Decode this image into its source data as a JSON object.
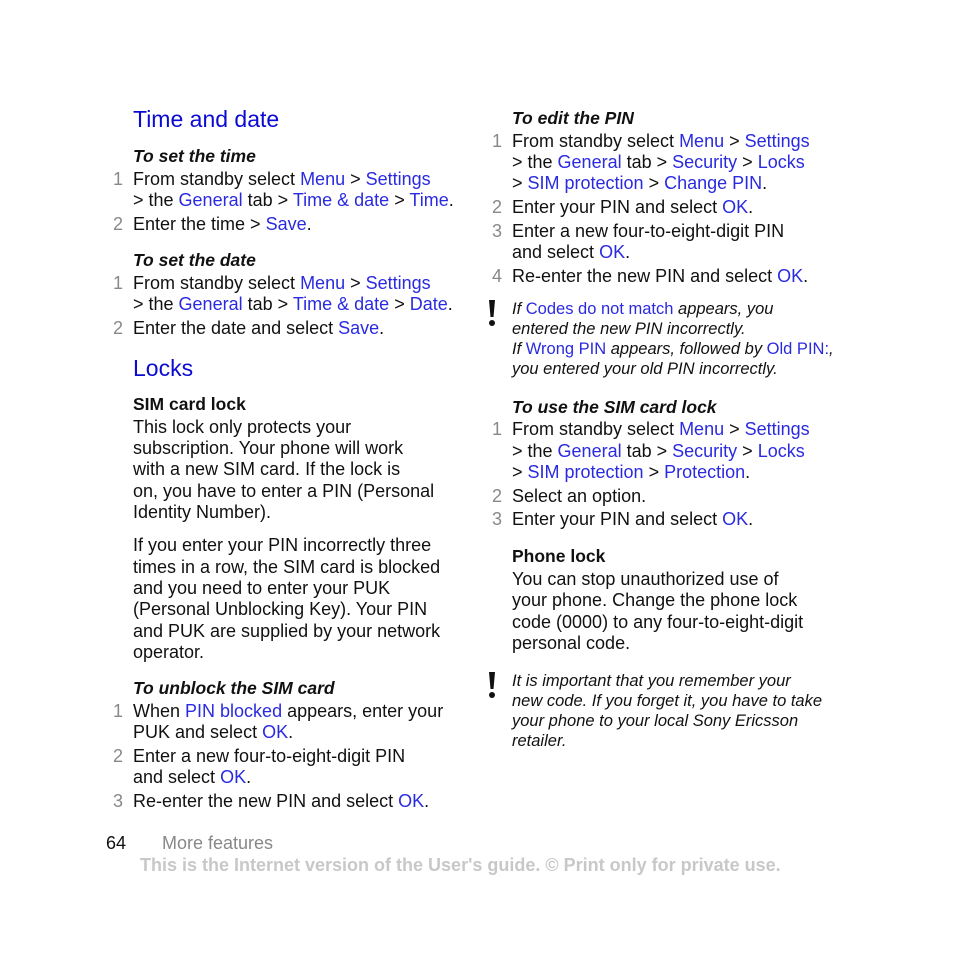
{
  "left": {
    "heading1": "Time and date",
    "set_time": {
      "title": "To set the time",
      "steps": [
        "1",
        "2"
      ]
    },
    "set_date": {
      "title": "To set the date"
    },
    "heading2": "Locks",
    "sim_lock": {
      "title": "SIM card lock",
      "p1": [
        "This lock only protects your",
        "subscription. Your phone will work",
        "with a new SIM card. If the lock is",
        "on, you have to enter a PIN (Personal",
        "Identity Number)."
      ],
      "p2": [
        "If you enter your PIN incorrectly three",
        "times in a row, the SIM card is blocked",
        "and you need to enter your PUK",
        "(Personal Unblocking Key). Your PIN",
        "and PUK are supplied by your network",
        "operator."
      ]
    },
    "unblock": {
      "title": "To unblock the SIM card"
    }
  },
  "right": {
    "edit_pin": {
      "title": "To edit the PIN"
    },
    "use_sim": {
      "title": "To use the SIM card lock"
    },
    "phone_lock": {
      "title": "Phone lock",
      "p": [
        "You can stop unauthorized use of",
        "your phone. Change the phone lock",
        "code (0000) to any four-to-eight-digit",
        "personal code."
      ]
    },
    "note2": [
      "It is important that you remember your",
      "new code. If you forget it, you have to take",
      "your phone to your local Sony Ericsson",
      "retailer."
    ]
  },
  "t": {
    "from": "From standby select ",
    "menu": "Menu",
    "gt": " > ",
    "settings": "Settings",
    "the": "> the ",
    "general": "General",
    "tab": " tab > ",
    "timedate": "Time & date",
    "time": "Time",
    "date": "Date",
    "save": "Save",
    "dot": ".",
    "enter_time": "Enter the time > ",
    "enter_date": "Enter the date and select ",
    "security": "Security",
    "locks": "Locks",
    "gt2": "> ",
    "simprot": "SIM protection",
    "changepin": "Change PIN",
    "protection": "Protection",
    "enter_pin": "Enter your PIN and select ",
    "ok": "OK",
    "new_pin": "Enter a new four-to-eight-digit PIN",
    "and_select": "and select ",
    "reenter": "Re-enter the new PIN and select ",
    "select_opt": "Select an option.",
    "when": "When ",
    "pinblocked": "PIN blocked",
    "appears_enter": " appears, enter your",
    "puk": "PUK and select ",
    "if": "If ",
    "codes": "Codes do not match",
    "appears_you": " appears, you",
    "entered_new": "entered the new PIN incorrectly.",
    "wrongpin": "Wrong PIN",
    "followed": " appears, followed by ",
    "oldpin": "Old PIN:",
    "comma": ",",
    "entered_old": "you entered your old PIN incorrectly.",
    "n1": "1",
    "n2": "2",
    "n3": "3",
    "n4": "4"
  },
  "footer": {
    "page": "64",
    "section": "More features",
    "notice": "This is the Internet version of the User's guide. © Print only for private use."
  }
}
